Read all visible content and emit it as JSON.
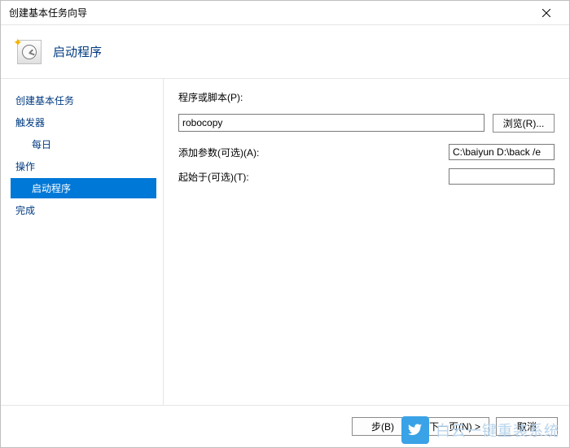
{
  "window": {
    "title": "创建基本任务向导"
  },
  "header": {
    "title": "启动程序"
  },
  "sidebar": {
    "items": [
      {
        "label": "创建基本任务"
      },
      {
        "label": "触发器"
      },
      {
        "label": "每日"
      },
      {
        "label": "操作"
      },
      {
        "label": "启动程序",
        "active": true
      },
      {
        "label": "完成"
      }
    ]
  },
  "form": {
    "program_label": "程序或脚本(P):",
    "program_value": "robocopy",
    "browse_label": "浏览(R)...",
    "args_label": "添加参数(可选)(A):",
    "args_value": "C:\\baiyun D:\\back /e",
    "startin_label": "起始于(可选)(T):",
    "startin_value": ""
  },
  "footer": {
    "back_label": "步(B)",
    "next_label": "下一页(N) >",
    "cancel_label": "取消"
  },
  "watermark": {
    "text": "白云一键重装系统",
    "url": "www.baiyunxitong.com"
  }
}
